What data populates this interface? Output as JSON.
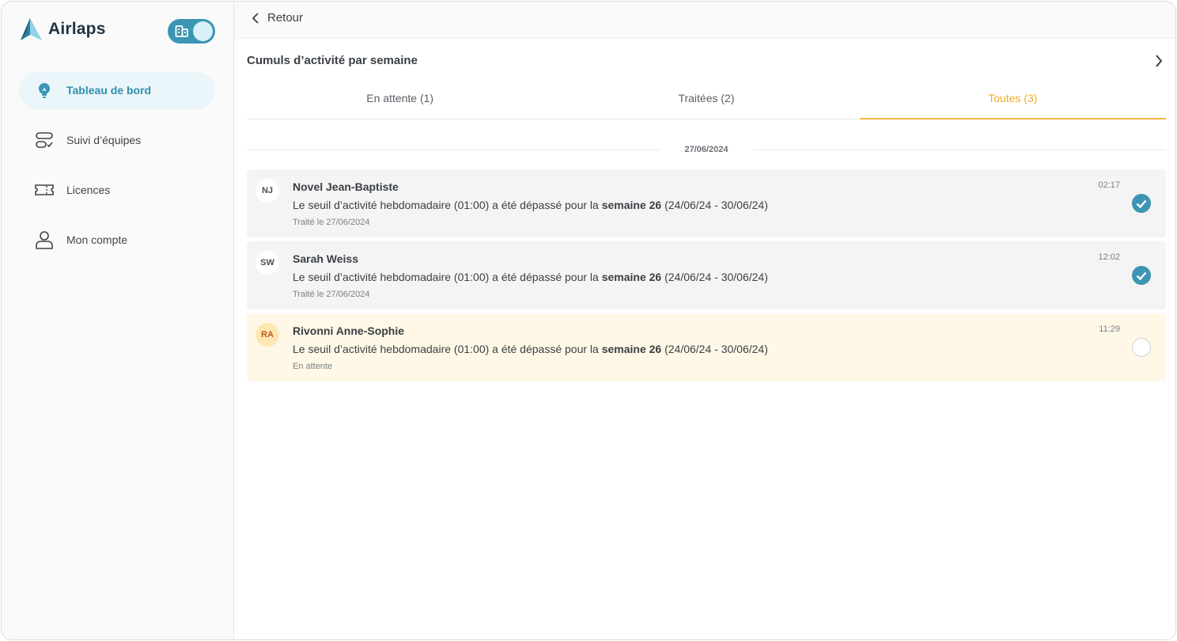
{
  "brand": {
    "name": "Airlaps",
    "accent": "#3b95b5"
  },
  "sidebar": {
    "items": [
      {
        "label": "Tableau de bord",
        "icon": "lightbulb-icon",
        "active": true
      },
      {
        "label": "Suivi d’équipes",
        "icon": "team-tracking-icon",
        "active": false
      },
      {
        "label": "Licences",
        "icon": "ticket-icon",
        "active": false
      },
      {
        "label": "Mon compte",
        "icon": "user-icon",
        "active": false
      }
    ]
  },
  "topbar": {
    "back_label": "Retour"
  },
  "section": {
    "title": "Cumuls d’activité par semaine"
  },
  "tabs": [
    {
      "label": "En attente (1)",
      "active": false
    },
    {
      "label": "Traitées (2)",
      "active": false
    },
    {
      "label": "Toutes (3)",
      "active": true
    }
  ],
  "date_separator": "27/06/2024",
  "cards": [
    {
      "initials": "NJ",
      "name": "Novel Jean-Baptiste",
      "msg_prefix": "Le seuil d’activité hebdomadaire (01:00) a été dépassé pour la ",
      "msg_bold": "semaine 26",
      "msg_suffix": " (24/06/24 - 30/06/24)",
      "status": "Traité le 27/06/2024",
      "time": "02:17",
      "done": true
    },
    {
      "initials": "SW",
      "name": "Sarah Weiss",
      "msg_prefix": "Le seuil d’activité hebdomadaire (01:00) a été dépassé pour la ",
      "msg_bold": "semaine 26",
      "msg_suffix": " (24/06/24 - 30/06/24)",
      "status": "Traité le 27/06/2024",
      "time": "12:02",
      "done": true
    },
    {
      "initials": "RA",
      "name": "Rivonni Anne-Sophie",
      "msg_prefix": "Le seuil d’activité hebdomadaire (01:00) a été dépassé pour la ",
      "msg_bold": "semaine 26",
      "msg_suffix": " (24/06/24 - 30/06/24)",
      "status": "En attente",
      "time": "11:29",
      "done": false
    }
  ],
  "colors": {
    "active_tab": "#f2ab2b",
    "pending_bg": "#fff8e7",
    "done_bg": "#f4f4f4",
    "check": "#3b95b5"
  }
}
